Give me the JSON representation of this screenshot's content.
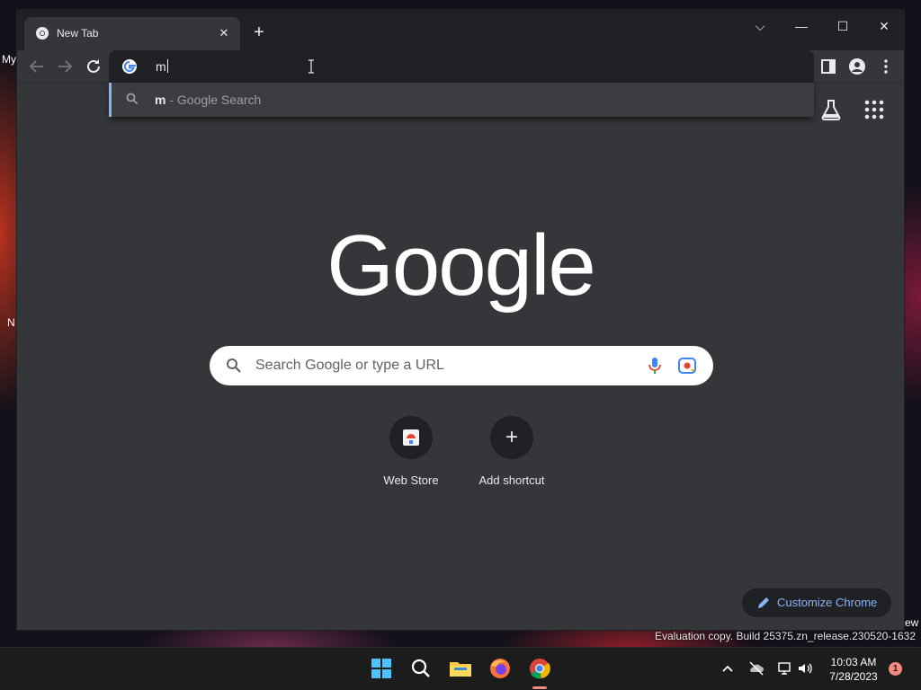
{
  "desktop": {
    "labels": [
      "My",
      "N"
    ],
    "edge_text": "ew",
    "eval_text": "Evaluation copy. Build 25375.zn_release.230520-1632"
  },
  "browser": {
    "tab": {
      "title": "New Tab",
      "close_glyph": "✕"
    },
    "new_tab_glyph": "+",
    "window_controls": {
      "tab_search": "⌵",
      "minimize": "—",
      "maximize": "☐",
      "close": "✕"
    },
    "omnibox": {
      "value": "m"
    },
    "dropdown": {
      "suggestion_query": "m",
      "suggestion_suffix": " - Google Search"
    }
  },
  "ntp": {
    "logo_text": "Google",
    "search_placeholder": "Search Google or type a URL",
    "shortcuts": [
      {
        "label": "Web Store"
      },
      {
        "label": "Add shortcut",
        "glyph": "+"
      }
    ],
    "customize_label": "Customize Chrome"
  },
  "taskbar": {
    "time": "10:03 AM",
    "date": "7/28/2023",
    "notification_count": "1"
  },
  "colors": {
    "accent": "#8ab4f8",
    "ntp_background": "#35363a",
    "titlebar": "#202124"
  }
}
